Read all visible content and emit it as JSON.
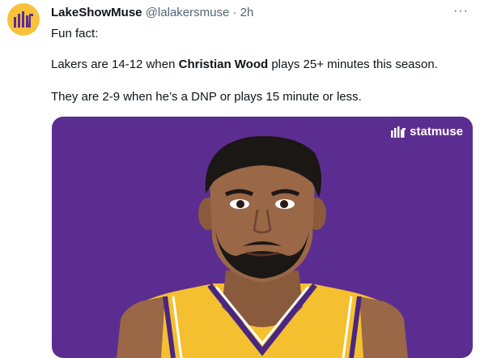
{
  "tweet": {
    "display_name": "LakeShowMuse",
    "handle": "@lalakersmuse",
    "separator": "·",
    "time": "2h",
    "more_label": "···",
    "line1": "Fun fact:",
    "line2_before": "Lakers are 14-12 when ",
    "line2_bold": "Christian Wood",
    "line2_after": " plays 25+ minutes this season.",
    "line3": "They are 2-9 when he’s a DNP or plays 15 minute or less."
  },
  "media": {
    "brand": "statmuse",
    "background": "#5c2d91",
    "jersey_color": "#f5c02f",
    "trim_color": "#4a2683",
    "skin_color": "#9a6747",
    "hair_color": "#1b1714"
  },
  "avatar": {
    "background": "#f9c23c",
    "icon": "statmuse-logo-icon"
  }
}
